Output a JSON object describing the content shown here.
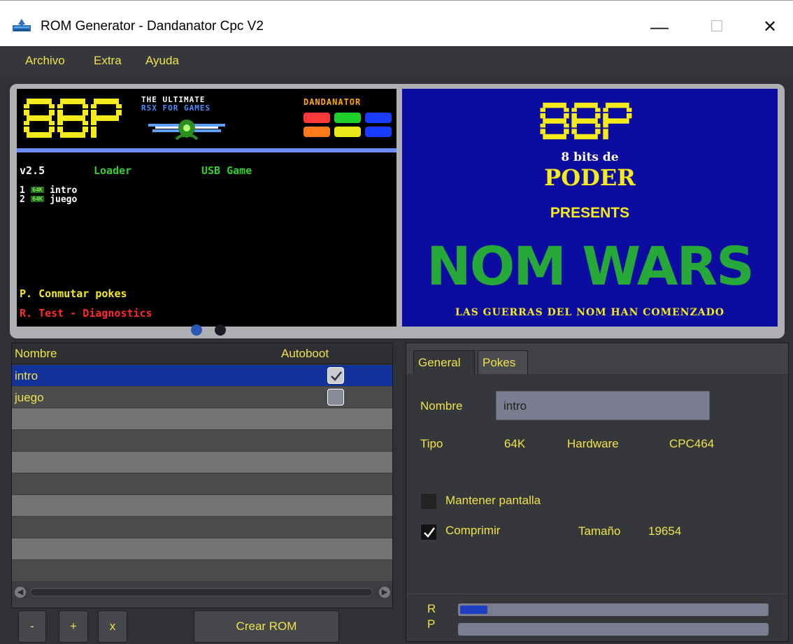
{
  "window": {
    "title": "ROM Generator - Dandanator Cpc V2",
    "controls": {
      "minimize": "—",
      "maximize": "☐",
      "close": "✕"
    }
  },
  "menu": [
    "Archivo",
    "Extra",
    "Ayuda"
  ],
  "preview_left": {
    "logo": "8BP",
    "tagline_1": "THE ULTIMATE",
    "tagline_2": "RSX FOR GAMES",
    "brand": "DANDANATOR",
    "version": "v2.5",
    "loader_label": "Loader",
    "usb_label": "USB Game",
    "entries": [
      {
        "num": "1",
        "badge": "64K",
        "name": "intro"
      },
      {
        "num": "2",
        "badge": "64K",
        "name": "juego"
      }
    ],
    "pokes_line": "P. Conmutar pokes",
    "test_line": "R. Test - Diagnostics"
  },
  "preview_right": {
    "logo": "8BP",
    "line1": "8 bits de",
    "line2": "PODER",
    "line3": "PRESENTS",
    "game_title": "NOM WARS",
    "subtitle": "LAS GUERRAS DEL NOM HAN COMENZADO"
  },
  "carousel": {
    "active_index": 1,
    "count": 2
  },
  "table": {
    "columns": [
      "Nombre",
      "Autoboot"
    ],
    "rows": [
      {
        "name": "intro",
        "autoboot": true,
        "selected": true
      },
      {
        "name": "juego",
        "autoboot": false,
        "selected": false
      }
    ]
  },
  "buttons": {
    "remove": "-",
    "add": "+",
    "clear": "x",
    "create": "Crear ROM"
  },
  "details": {
    "tabs": [
      "General",
      "Pokes"
    ],
    "active_tab": "General",
    "nombre_label": "Nombre",
    "nombre_value": "intro",
    "tipo_label": "Tipo",
    "tipo_value": "64K",
    "hardware_label": "Hardware",
    "hardware_value": "CPC464",
    "mantener_label": "Mantener pantalla",
    "mantener_checked": false,
    "comprimir_label": "Comprimir",
    "comprimir_checked": true,
    "tamano_label": "Tamaño",
    "tamano_value": "19654"
  },
  "progress": {
    "r_label": "R",
    "r_fraction": 0.09,
    "p_label": "P",
    "p_fraction": 0.0
  },
  "colors": {
    "accent_text": "#f0e24c",
    "selection": "#13329a",
    "progress_fill": "#1e3fbf"
  }
}
